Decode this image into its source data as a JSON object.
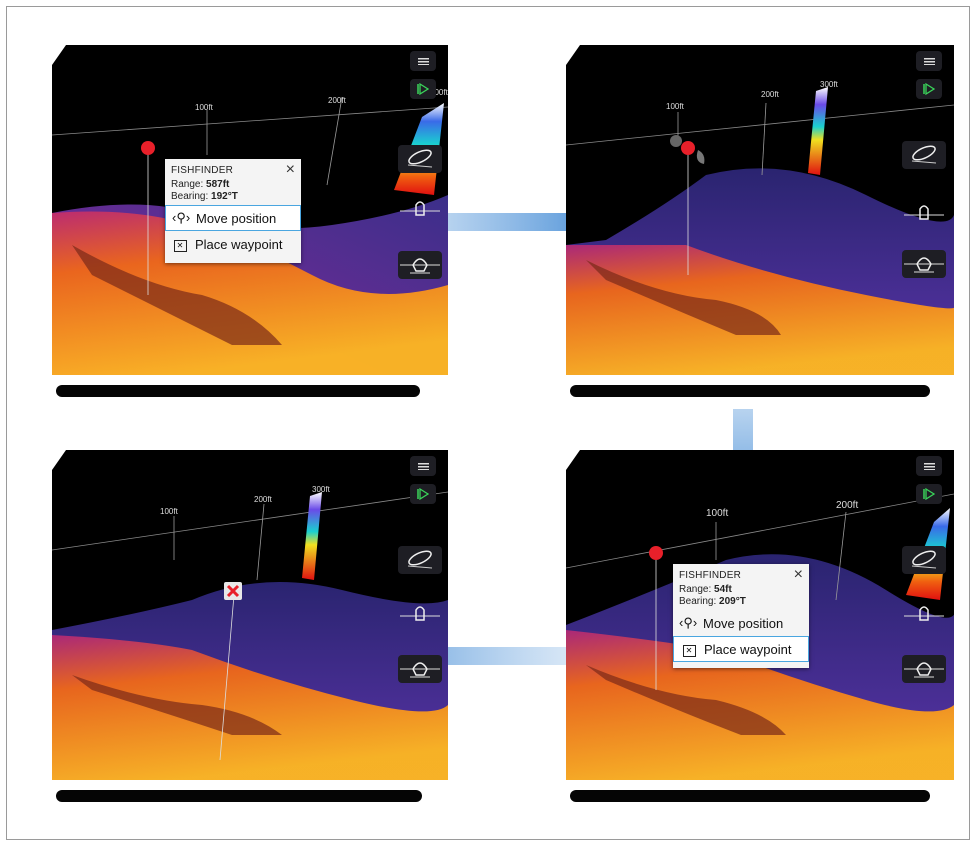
{
  "panels": [
    {
      "id": "top-left",
      "range_labels": [
        "100ft",
        "200ft",
        "300ft"
      ],
      "popup": {
        "title": "FISHFINDER",
        "range_label": "Range:",
        "range_value": "587ft",
        "bearing_label": "Bearing:",
        "bearing_value": "192°T",
        "option1": "Move position",
        "option2": "Place waypoint",
        "selected": "option1"
      }
    },
    {
      "id": "top-right",
      "range_labels": [
        "100ft",
        "200ft",
        "300ft"
      ]
    },
    {
      "id": "bottom-left",
      "range_labels": [
        "100ft",
        "200ft",
        "300ft"
      ]
    },
    {
      "id": "bottom-right",
      "range_labels": [
        "100ft",
        "200ft"
      ],
      "popup": {
        "title": "FISHFINDER",
        "range_label": "Range:",
        "range_value": "54ft",
        "bearing_label": "Bearing:",
        "bearing_value": "209°T",
        "option1": "Move position",
        "option2": "Place waypoint",
        "selected": "option2"
      }
    }
  ],
  "colors": {
    "arrow": "#2f7fd1",
    "sonar_hot": "#ffb000",
    "sonar_mid": "#e0208a",
    "sonar_low": "#4a3aa8",
    "water": "#000000",
    "marker": "#e8202a",
    "play": "#3ad45a"
  },
  "icons": [
    "menu-icon",
    "play-icon",
    "boat-top-icon",
    "boat-side-icon",
    "boat-front-icon",
    "close-icon",
    "move-position-icon",
    "waypoint-icon",
    "waypoint-x-icon",
    "arrow-right",
    "arrow-down",
    "arrow-left"
  ]
}
